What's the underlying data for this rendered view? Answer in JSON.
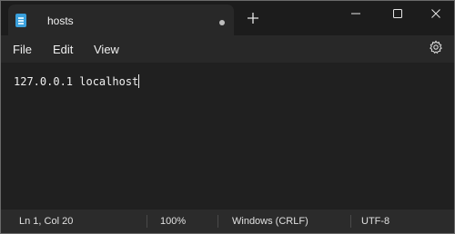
{
  "tab": {
    "title": "hosts",
    "icon": "notepad-icon",
    "unsaved_indicator": true
  },
  "menu": {
    "items": [
      "File",
      "Edit",
      "View"
    ]
  },
  "editor": {
    "content": "127.0.0.1 localhost"
  },
  "status": {
    "position": "Ln 1, Col 20",
    "zoom": "100%",
    "line_ending": "Windows (CRLF)",
    "encoding": "UTF-8"
  },
  "colors": {
    "background": "#202020",
    "tab_active": "#282828",
    "icon_accent": "#3aa0dc"
  }
}
